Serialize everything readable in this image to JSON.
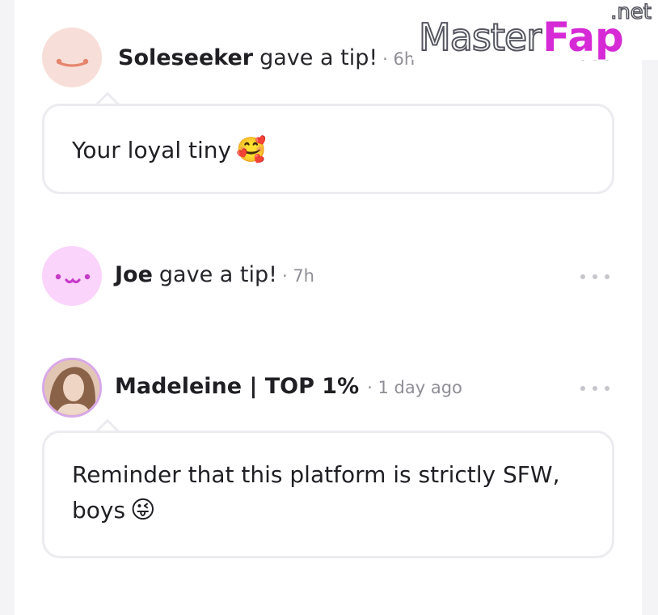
{
  "feed": [
    {
      "name": "Soleseeker",
      "action": "gave a tip!",
      "meta": "· 6h",
      "message": "Your loyal tiny",
      "emoji": "🥰"
    },
    {
      "name": "Joe",
      "action": "gave a tip!",
      "meta": "· 7h"
    },
    {
      "name": "Madeleine | TOP 1%",
      "meta": "· 1 day ago",
      "message_line1": "Reminder that this platform is strictly SFW,",
      "message_line2": "boys",
      "emoji": "😜"
    }
  ],
  "watermark": {
    "master": "Master",
    "fap": "Fap",
    "net": ".net"
  },
  "colors": {
    "avatar_1_bg": "#f8ded8",
    "avatar_1_face": "#e6856c",
    "avatar_2_bg": "#fbd4fb",
    "avatar_2_face": "#c63bc9",
    "brand_pink": "#d62ad6"
  }
}
